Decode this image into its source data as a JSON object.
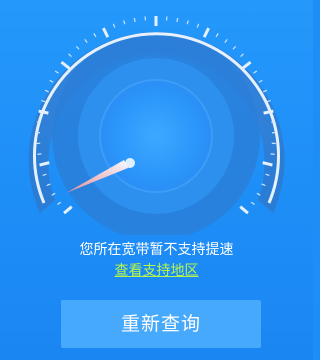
{
  "gauge": {
    "needle_value": 0,
    "colors": {
      "background": "#1e8ef7",
      "outer_ring": "#2e80d8",
      "ticks": "#e6f1ff",
      "inner_disk": "#34a0ff",
      "needle": "#ffb7b7"
    }
  },
  "status": {
    "message": "您所在宽带暂不支持提速",
    "link_label": "查看支持地区"
  },
  "retry_button": {
    "label": "重新查询"
  }
}
